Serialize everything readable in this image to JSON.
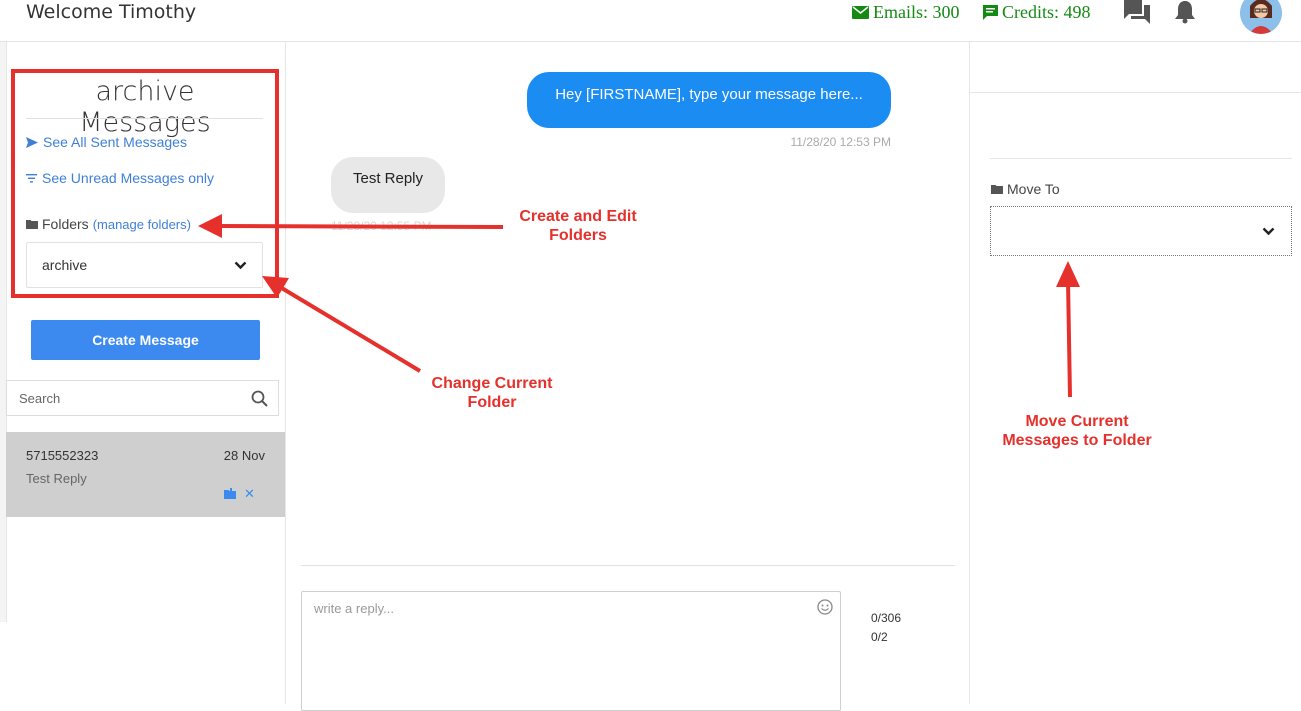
{
  "header": {
    "welcome": "Welcome Timothy",
    "emails": "Emails: 300",
    "credits": "Credits: 498",
    "stat_color": "#148a14"
  },
  "left": {
    "title": "archive Messages",
    "see_all_sent": "See All Sent Messages",
    "see_unread": "See Unread Messages only",
    "folders_label": "Folders",
    "manage_folders": "(manage folders)",
    "folder_selected": "archive",
    "create_message": "Create Message",
    "search_placeholder": "Search",
    "messages": [
      {
        "phone": "5715552323",
        "date": "28 Nov",
        "preview": "Test Reply"
      }
    ]
  },
  "conversation": {
    "outgoing_text": "Hey [FIRSTNAME], type your message here...",
    "outgoing_time": "11/28/20 12:53 PM",
    "incoming_text": "Test Reply",
    "incoming_time": "11/28/20 12:55 PM",
    "reply_placeholder": "write a reply...",
    "char_counter": "0/306",
    "segment_counter": "0/2",
    "outgoing_color": "#1a8cf2"
  },
  "right": {
    "move_to_label": "Move To"
  },
  "annotations": {
    "create_edit": "Create and Edit Folders",
    "change_folder": "Change Current Folder",
    "move_messages": "Move Current Messages to Folder",
    "color": "#e5302b"
  }
}
